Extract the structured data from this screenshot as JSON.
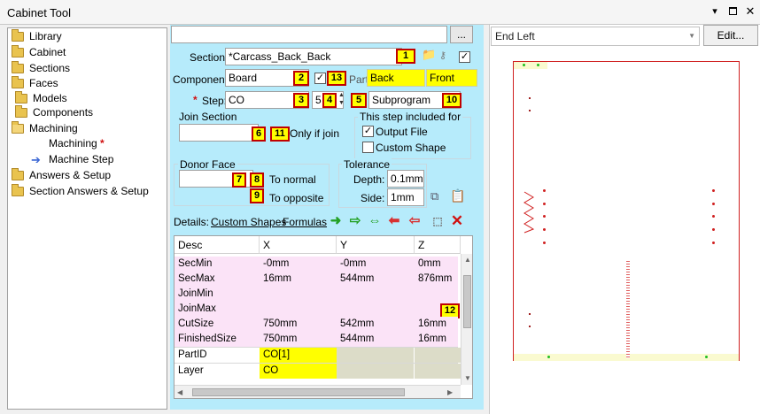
{
  "window": {
    "title": "Cabinet Tool"
  },
  "tree": {
    "items": [
      {
        "label": "Library"
      },
      {
        "label": "Cabinet"
      },
      {
        "label": "Sections"
      },
      {
        "label": "Faces"
      },
      {
        "label": "Models"
      },
      {
        "label": "Components"
      },
      {
        "label": "Machining"
      },
      {
        "label": "Machining",
        "required": "*"
      },
      {
        "label": "Machine Step"
      },
      {
        "label": "Answers & Setup"
      },
      {
        "label": "Section Answers & Setup"
      }
    ]
  },
  "form": {
    "top_button": "...",
    "section_label": "Section:",
    "section_value": "*Carcass_Back_Back",
    "component_label": "Component:",
    "component_value": "Board",
    "part_label": "Part:",
    "part_back": "Back",
    "part_front": "Front",
    "step_star": "*",
    "step_label": "Step:",
    "step_value": "CO",
    "step_number": "5",
    "subprogram_value": "Subprogram",
    "join_section_label": "Join Section",
    "only_if_join_label": "Only if join",
    "step_included_label": "This step included for",
    "output_file_label": "Output File",
    "output_file_checked": true,
    "custom_shape_label": "Custom Shape",
    "custom_shape_checked": false,
    "donor_face_label": "Donor Face",
    "to_normal_label": "To normal",
    "to_opposite_label": "To opposite",
    "tolerance_label": "Tolerance",
    "depth_label": "Depth:",
    "depth_value": "0.1mm",
    "side_label": "Side:",
    "side_value": "1mm"
  },
  "callouts": {
    "c1": "1",
    "c2": "2",
    "c3": "3",
    "c4": "4",
    "c5": "5",
    "c6": "6",
    "c7": "7",
    "c8": "8",
    "c9": "9",
    "c10": "10",
    "c11": "11",
    "c12": "12",
    "c13": "13"
  },
  "details": {
    "label": "Details:",
    "tabs": [
      "Custom Shapes",
      "Formulas"
    ]
  },
  "grid": {
    "headers": [
      "Desc",
      "X",
      "Y",
      "Z"
    ],
    "rows": [
      {
        "desc": "SecMin",
        "x": "-0mm",
        "y": "-0mm",
        "z": "0mm"
      },
      {
        "desc": "SecMax",
        "x": "16mm",
        "y": "544mm",
        "z": "876mm"
      },
      {
        "desc": "JoinMin",
        "x": "",
        "y": "",
        "z": ""
      },
      {
        "desc": "JoinMax",
        "x": "",
        "y": "",
        "z": ""
      },
      {
        "desc": "CutSize",
        "x": "750mm",
        "y": "542mm",
        "z": "16mm"
      },
      {
        "desc": "FinishedSize",
        "x": "750mm",
        "y": "544mm",
        "z": "16mm"
      },
      {
        "desc": "PartID",
        "x": "CO[1]",
        "y": "",
        "z": ""
      },
      {
        "desc": "Layer",
        "x": "CO",
        "y": "",
        "z": ""
      }
    ]
  },
  "preview": {
    "view_value": "End Left",
    "edit_button": "Edit..."
  },
  "icons": {
    "folder": "folder-icon",
    "arrow": "arrow-right-icon",
    "pin": "pin-icon",
    "maximize": "maximize-icon",
    "close": "close-icon"
  },
  "colors": {
    "form_bg": "#b6ebfb",
    "callout_bg": "#ffff00",
    "callout_border": "#c00000",
    "grid_pink": "#fbe3f7",
    "required": "#d01010"
  }
}
